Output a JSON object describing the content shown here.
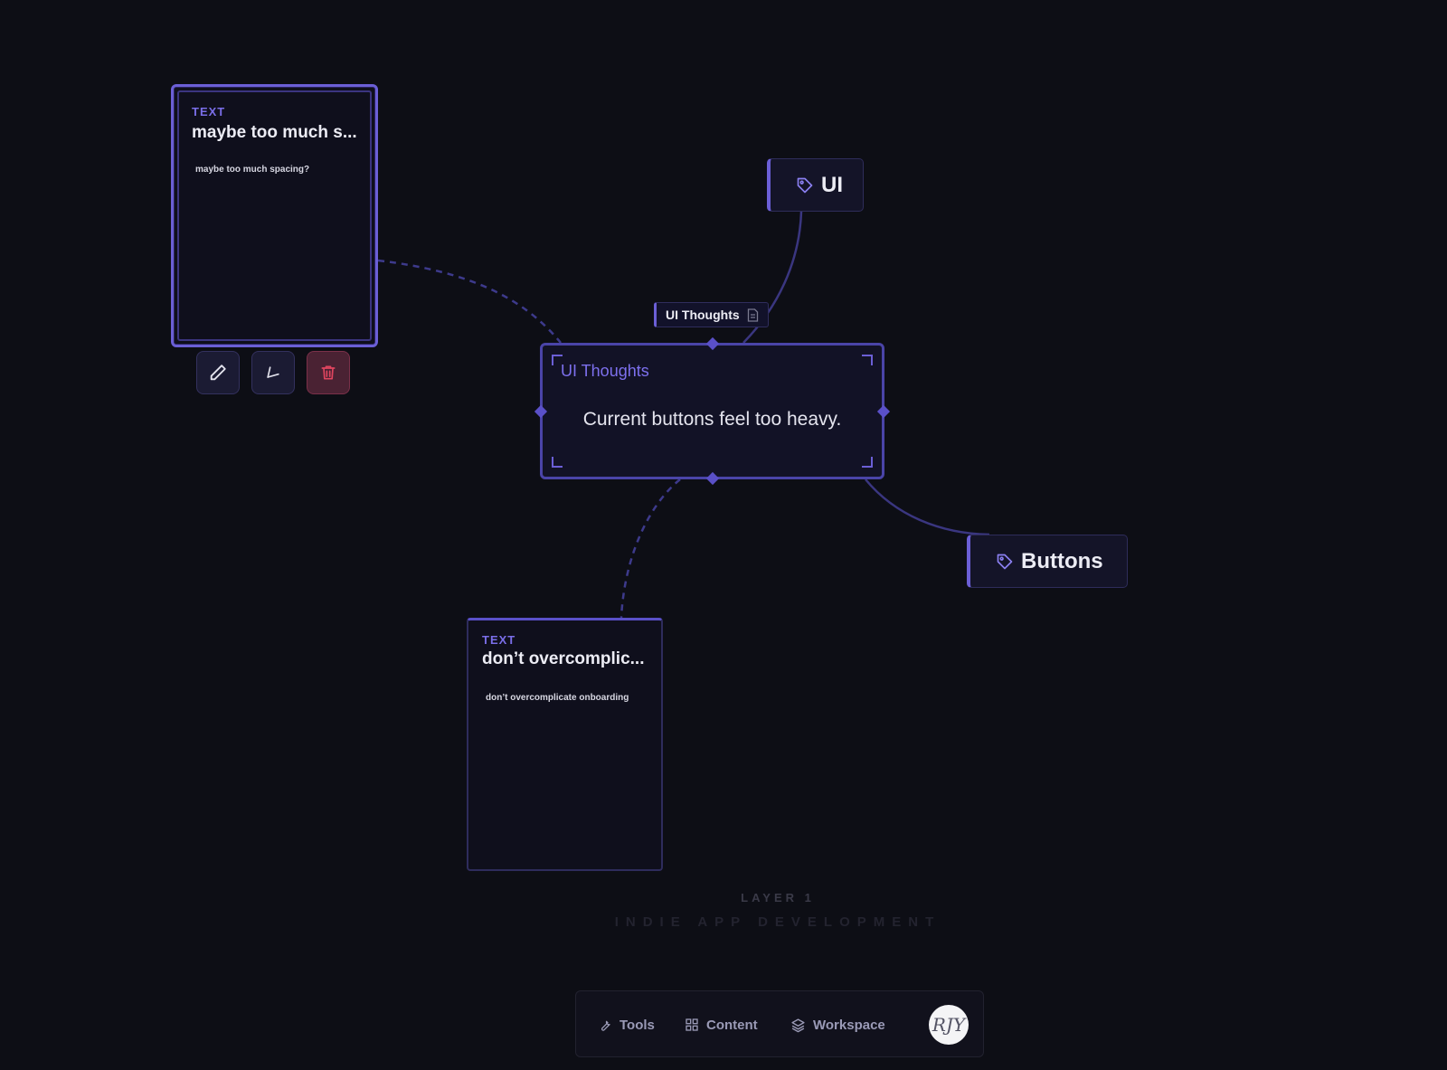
{
  "cards": [
    {
      "type_label": "TEXT",
      "title": "maybe too much s...",
      "body": "maybe too much spacing?"
    },
    {
      "type_label": "TEXT",
      "title": "don’t overcomplic...",
      "body": "don’t overcomplicate onboarding"
    }
  ],
  "card_toolbar": {
    "edit_icon": "pencil-icon",
    "back_icon": "arrow-back-icon",
    "delete_icon": "trash-icon"
  },
  "note": {
    "label": "UI Thoughts",
    "label_icon": "document-icon",
    "title": "UI Thoughts",
    "body": "Current buttons feel too heavy."
  },
  "tags": [
    {
      "label": "UI",
      "icon": "tag-icon"
    },
    {
      "label": "Buttons",
      "icon": "tag-icon"
    }
  ],
  "layer": {
    "label": "LAYER 1",
    "workspace": "INDIE APP DEVELOPMENT"
  },
  "dock": {
    "tools": "Tools",
    "tools_icon": "wrench-icon",
    "content": "Content",
    "content_icon": "grid-icon",
    "workspace": "Workspace",
    "workspace_icon": "layers-icon",
    "avatar_initials": "RJY"
  },
  "colors": {
    "background": "#0d0e15",
    "accent": "#6b5fd6",
    "danger": "#e0455f"
  }
}
